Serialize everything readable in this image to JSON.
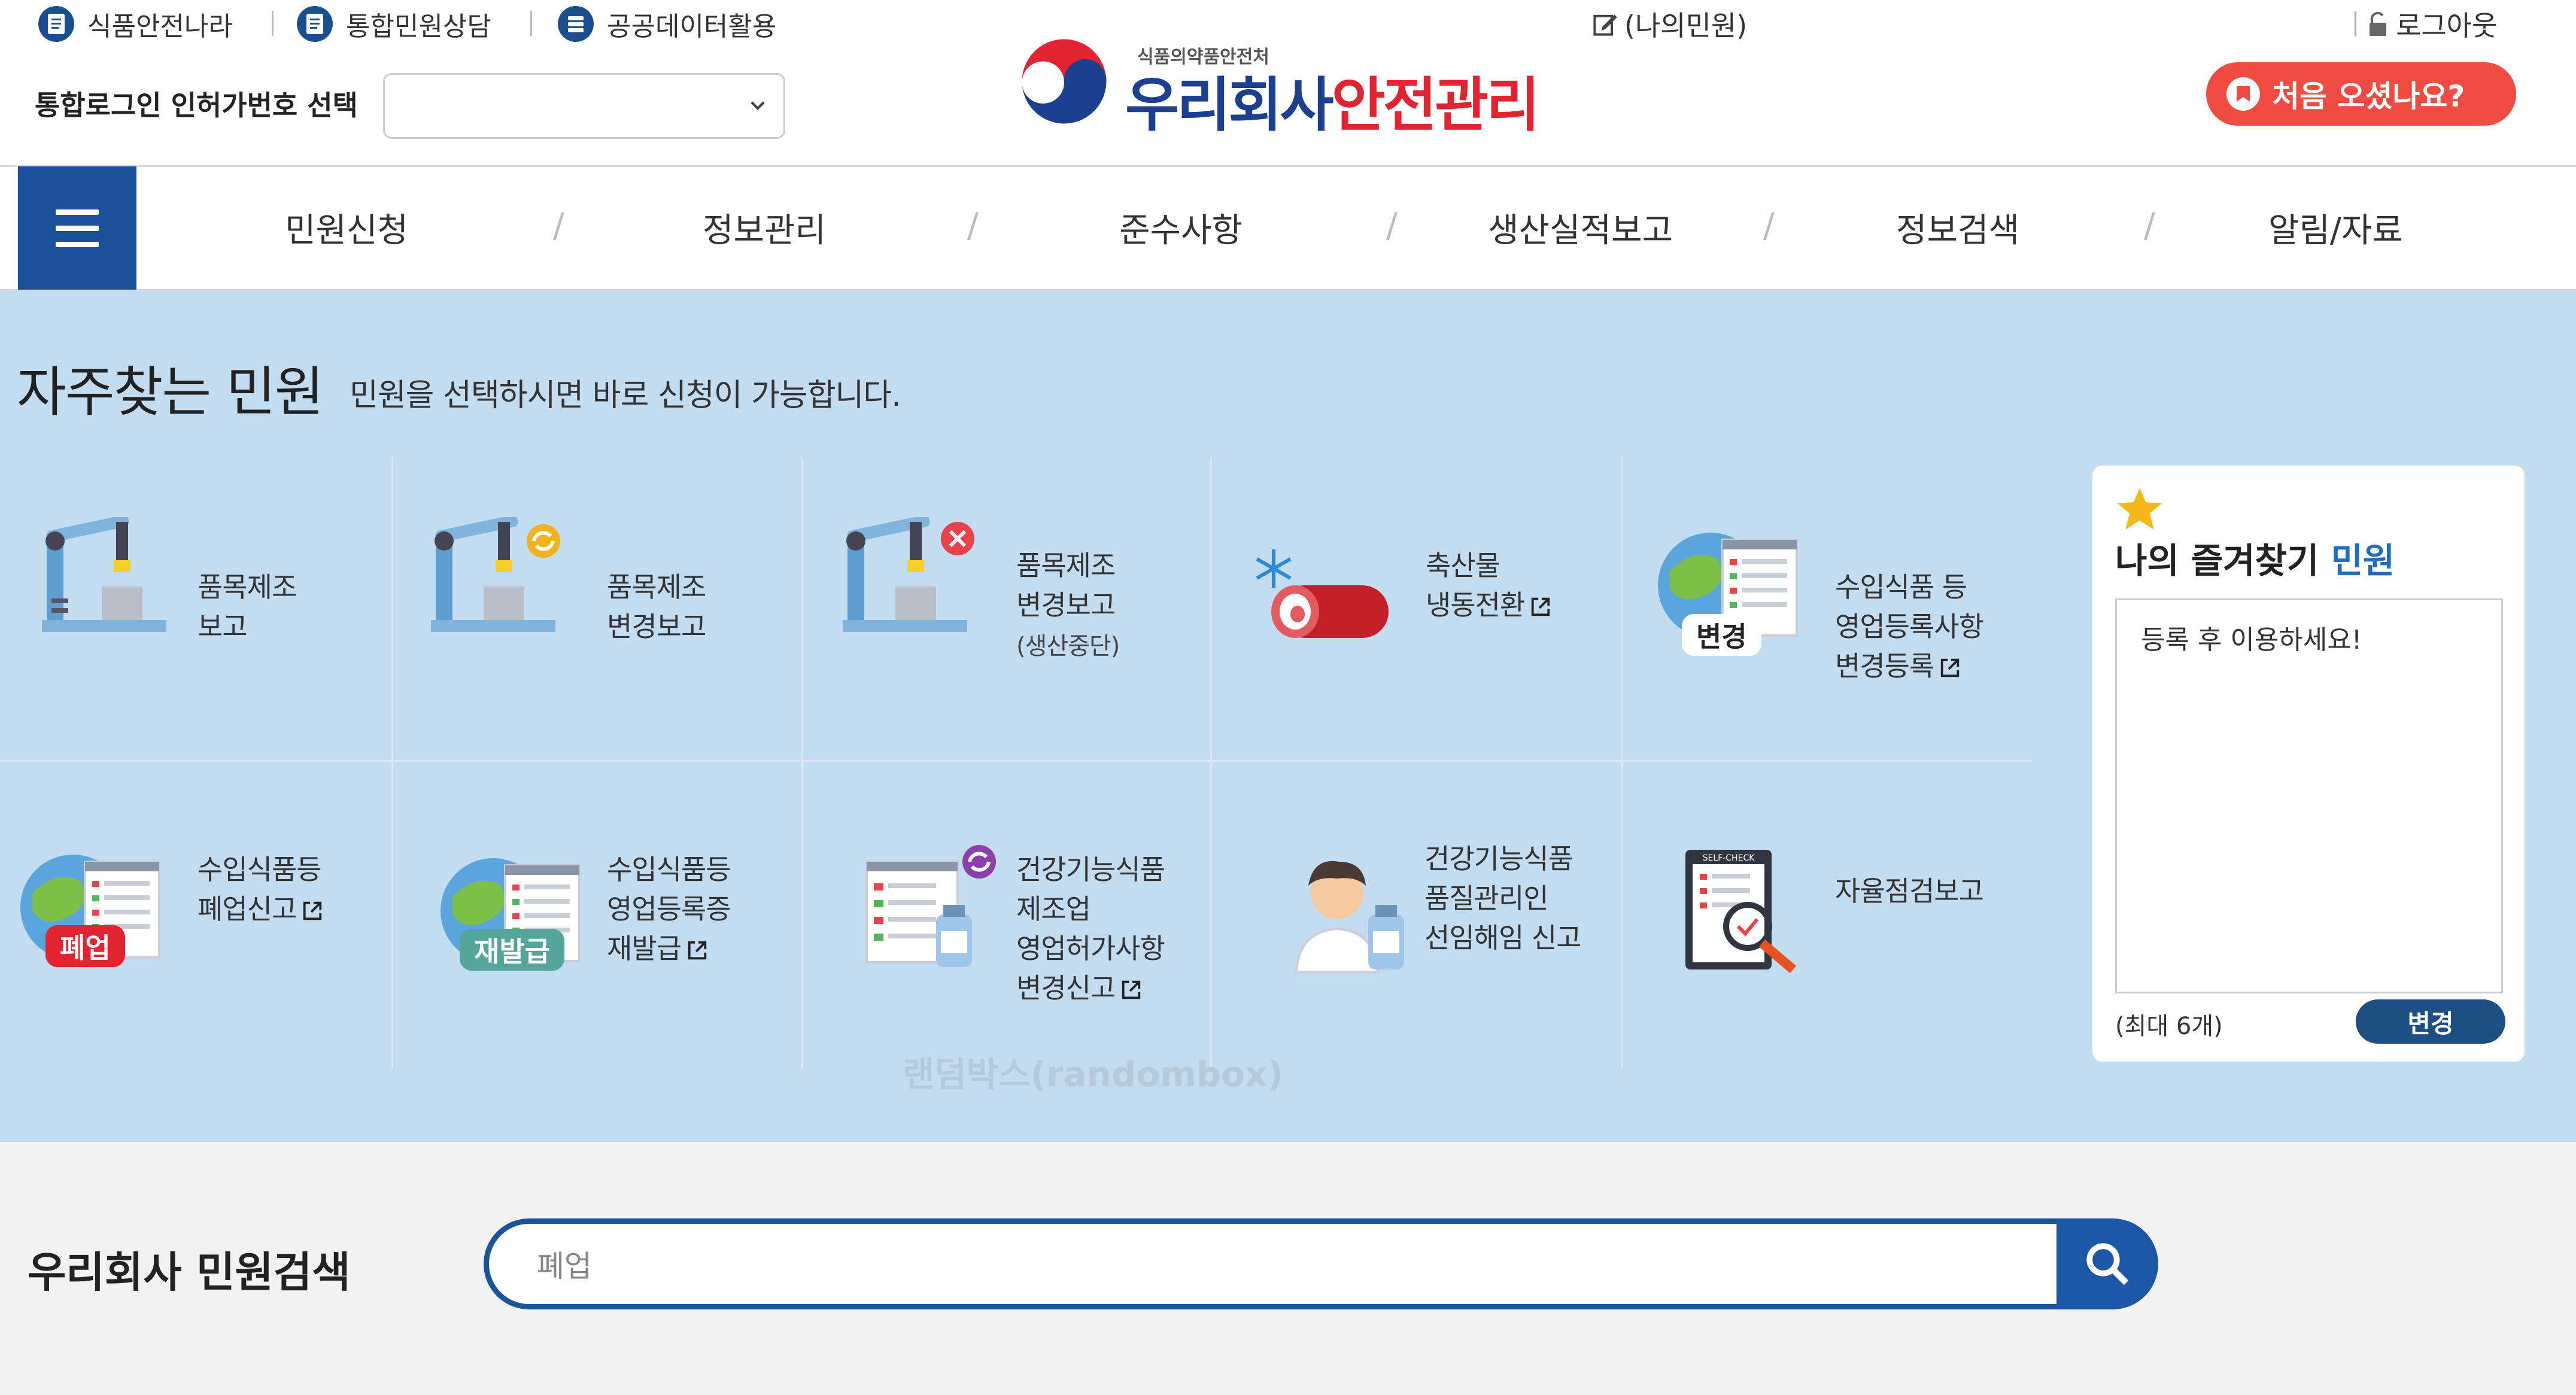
{
  "top_links": {
    "food_safety_korea": "식품안전나라",
    "integrated_consult": "통합민원상담",
    "public_data": "공공데이터활용"
  },
  "login": {
    "label": "통합로그인 인허가번호 선택",
    "selected": ""
  },
  "logo": {
    "ministry": "식품의약품안전처",
    "title_blue": "우리회사",
    "title_red": "안전관리"
  },
  "my_civil": "(나의민원)",
  "logout": "로그아웃",
  "first_visit_button": "처음 오셨나요?",
  "nav": {
    "items": [
      "민원신청",
      "정보관리",
      "준수사항",
      "생산실적보고",
      "정보검색",
      "알림/자료"
    ]
  },
  "frequent": {
    "title": "자주찾는 민원",
    "subtitle": "민원을 선택하시면 바로 신청이 가능합니다.",
    "tiles": [
      {
        "label": "품목제조\n보고"
      },
      {
        "label": "품목제조\n변경보고"
      },
      {
        "label": "품목제조\n변경보고",
        "sub": "(생산중단)"
      },
      {
        "label": "축산물\n냉동전환"
      },
      {
        "label": "수입식품 등\n영업등록사항\n변경등록",
        "badge": "변경"
      },
      {
        "label": "수입식품등\n폐업신고",
        "badge": "폐업"
      },
      {
        "label": "수입식품등\n영업등록증\n재발급",
        "badge": "재발급"
      },
      {
        "label": "건강기능식품\n제조업\n영업허가사항\n변경신고"
      },
      {
        "label": "건강기능식품\n품질관리인\n선임해임 신고"
      },
      {
        "label": "자율점검보고",
        "icon_text": "SELF-CHECK"
      }
    ]
  },
  "favorites": {
    "title": "나의 즐겨찾기",
    "title_accent": "민원",
    "hint": "등록 후 이용하세요!",
    "max_note": "(최대 6개)",
    "change_button": "변경"
  },
  "watermark": "랜덤박스(randombox)",
  "search": {
    "title": "우리회사 민원검색",
    "value": "폐업"
  },
  "colors": {
    "navy": "#1a4f9a",
    "red": "#ef4b40",
    "blue_bg": "#c3dcef",
    "search_border": "#1a5599"
  }
}
